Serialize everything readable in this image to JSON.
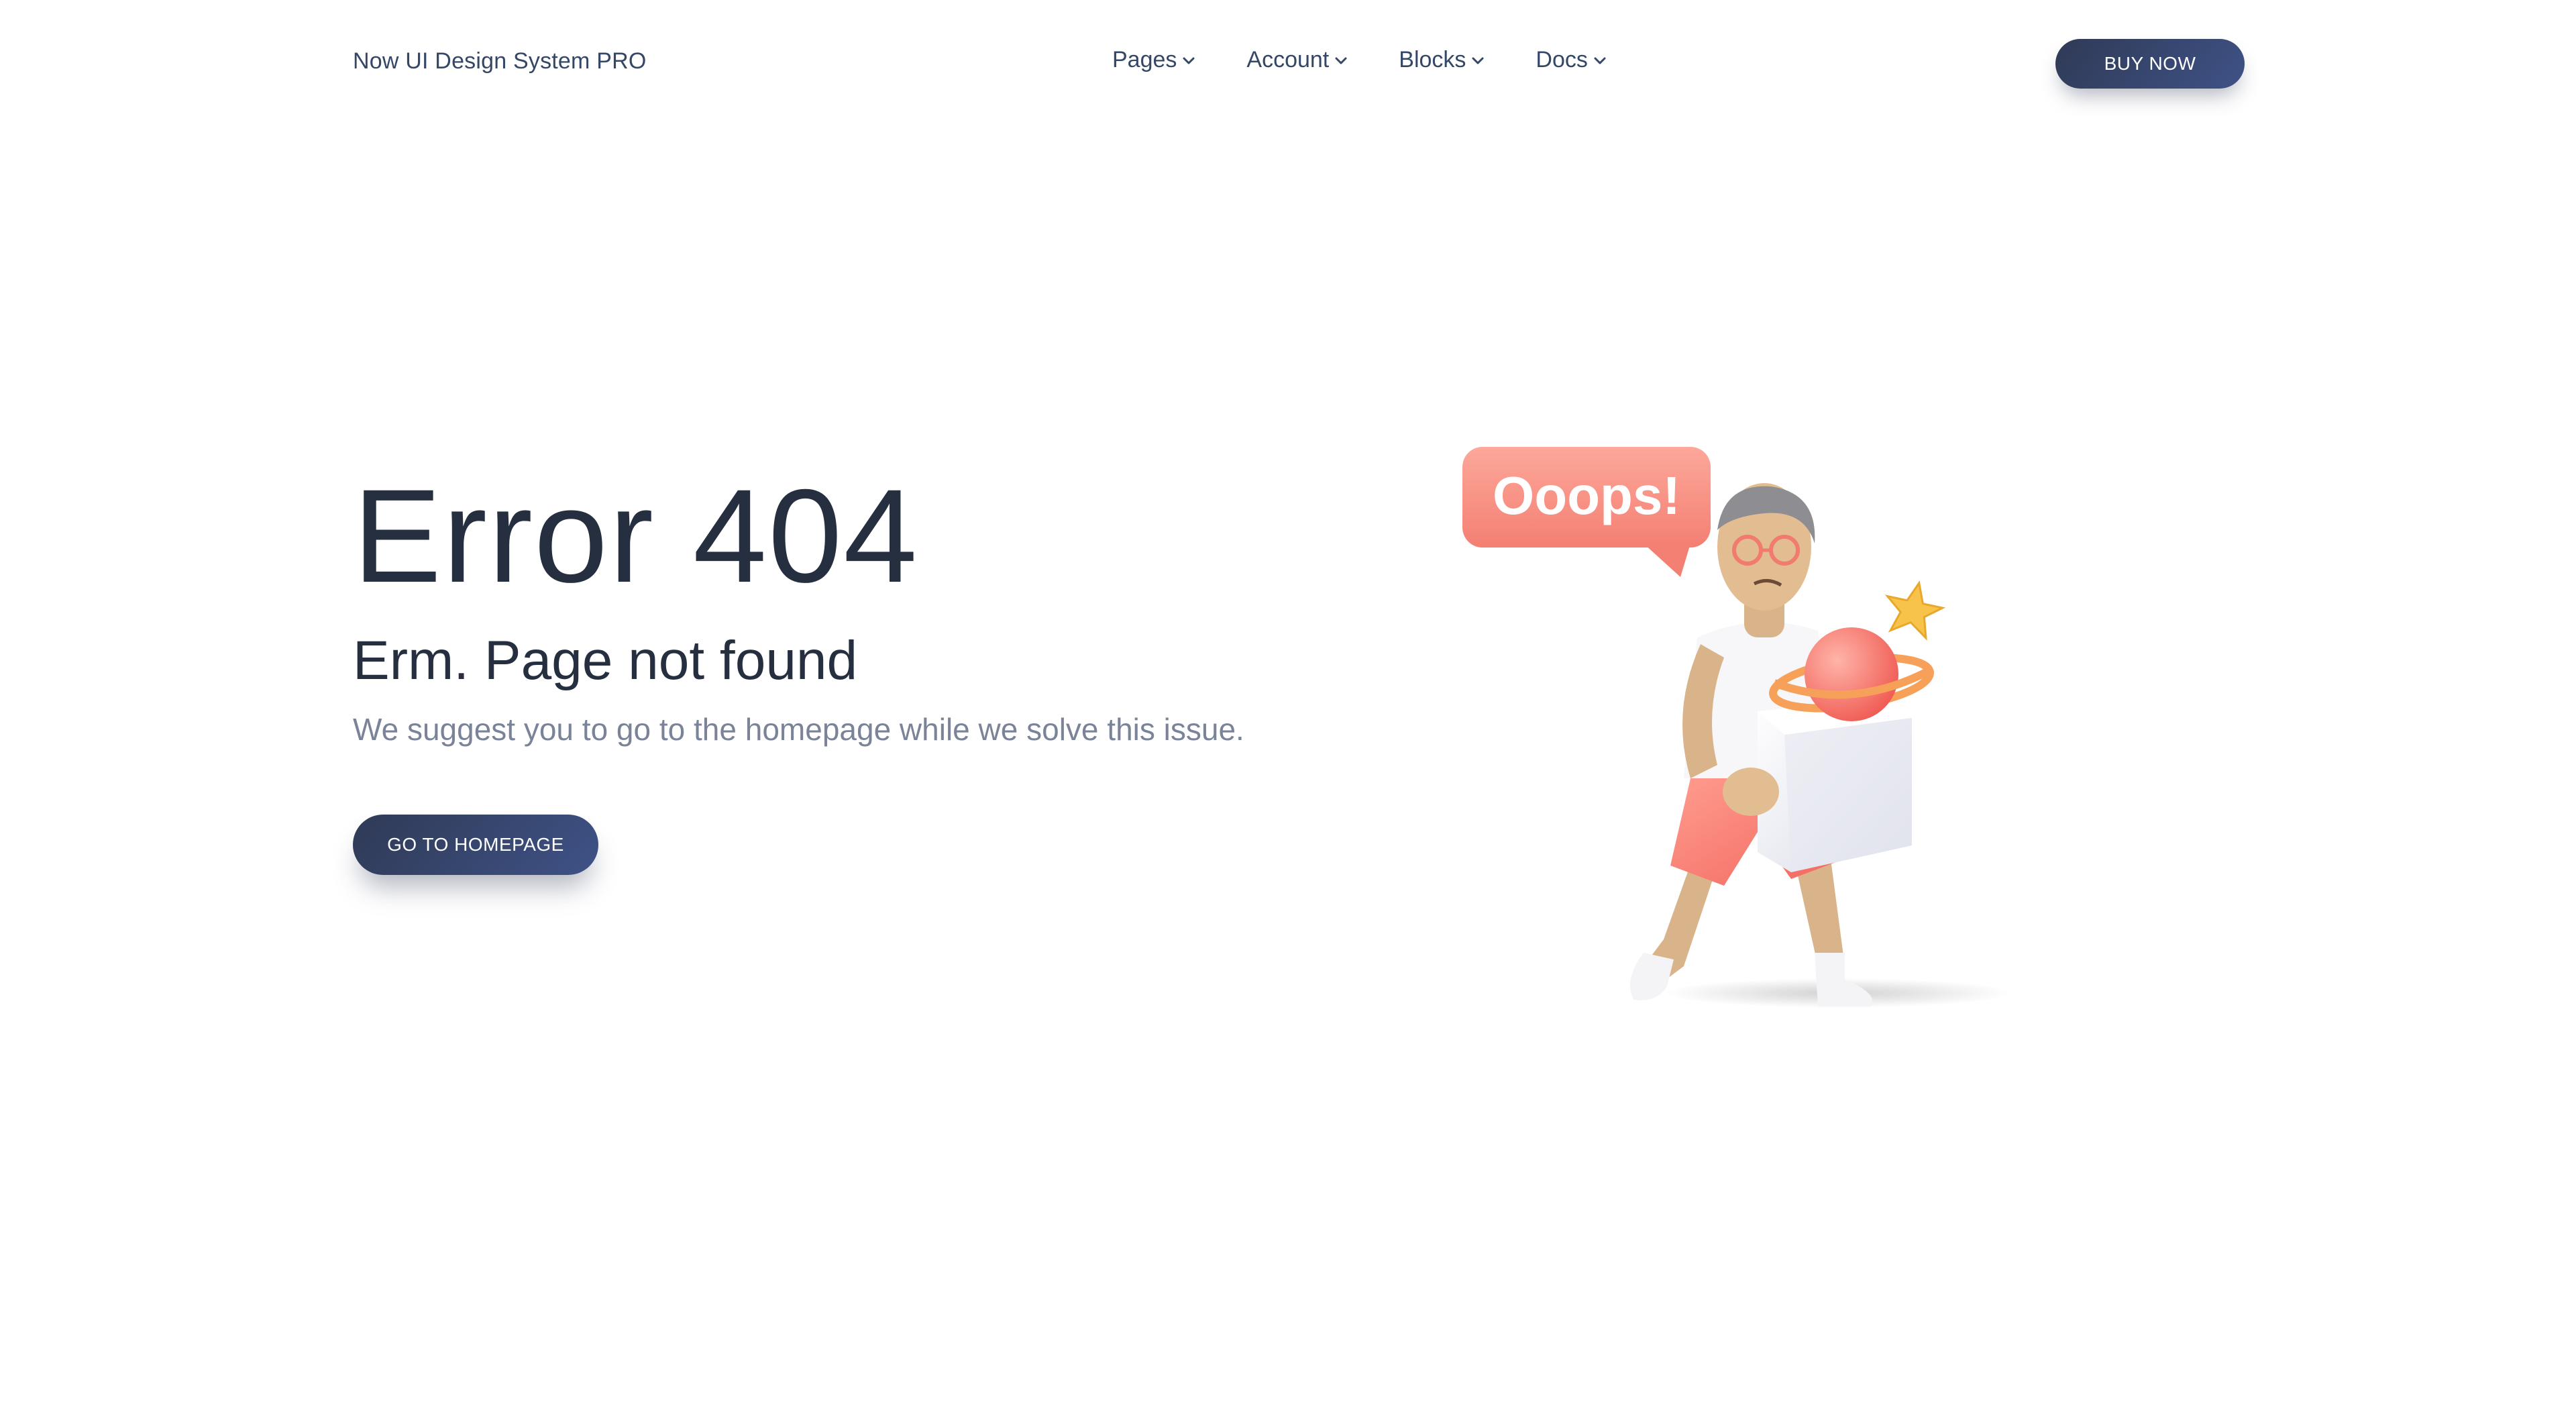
{
  "navbar": {
    "brand": "Now UI Design System PRO",
    "links": [
      {
        "label": "Pages",
        "icon": "chevron-down-icon"
      },
      {
        "label": "Account",
        "icon": "chevron-down-icon"
      },
      {
        "label": "Blocks",
        "icon": "chevron-down-icon"
      },
      {
        "label": "Docs",
        "icon": "chevron-down-icon"
      }
    ],
    "buy_button": "BUY NOW"
  },
  "main": {
    "title": "Error 404",
    "subtitle": "Erm. Page not found",
    "description": "We suggest you to go to the homepage while we solve this issue.",
    "home_button": "GO TO HOMEPAGE"
  },
  "illustration": {
    "bubble_text": "Ooops!",
    "icon": "person-carrying-box-illustration"
  },
  "colors": {
    "primary_dark": "#2f3a55",
    "primary_gradient_end": "#3f5287",
    "heading": "#252f40",
    "muted_text": "#7b8399",
    "bubble": "#f98b7e"
  }
}
